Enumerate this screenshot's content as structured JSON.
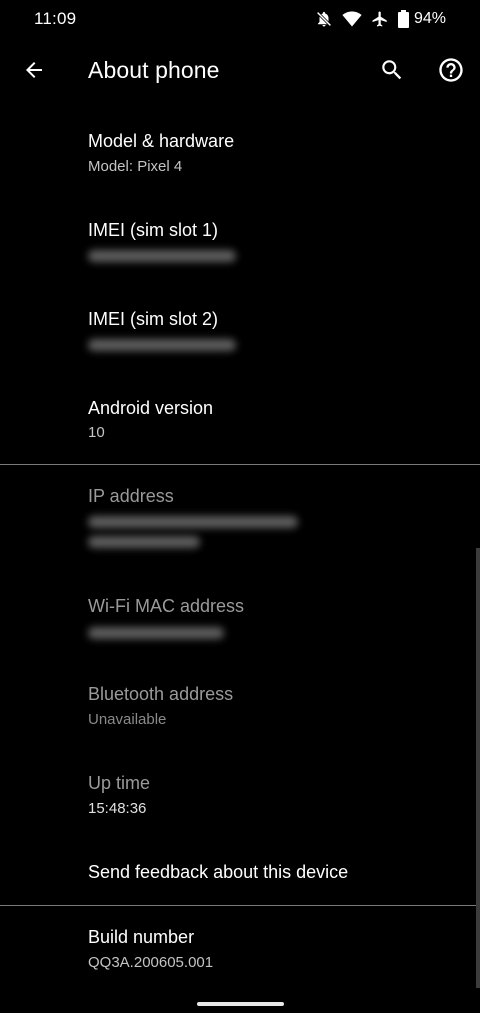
{
  "status_bar": {
    "time": "11:09",
    "battery": "94%",
    "icons": [
      "mute-notification-icon",
      "wifi-icon",
      "airplane-mode-icon",
      "battery-icon"
    ]
  },
  "app_bar": {
    "title": "About phone",
    "icons": [
      "back-arrow-icon",
      "search-icon",
      "help-icon"
    ]
  },
  "items": {
    "model": {
      "title": "Model & hardware",
      "summary": "Model: Pixel 4"
    },
    "imei1": {
      "title": "IMEI (sim slot 1)"
    },
    "imei2": {
      "title": "IMEI (sim slot 2)"
    },
    "android": {
      "title": "Android version",
      "summary": "10"
    },
    "ip": {
      "title": "IP address"
    },
    "wifi_mac": {
      "title": "Wi-Fi MAC address"
    },
    "bluetooth": {
      "title": "Bluetooth address",
      "summary": "Unavailable"
    },
    "uptime": {
      "title": "Up time",
      "summary": "15:48:36"
    },
    "feedback": {
      "title": "Send feedback about this device"
    },
    "build": {
      "title": "Build number",
      "summary": "QQ3A.200605.001"
    }
  },
  "colors": {
    "background": "#000000",
    "text_primary": "#ffffff",
    "text_secondary": "#c4c4c4",
    "text_disabled": "#9a9a9a",
    "divider": "#7a7a7a"
  }
}
